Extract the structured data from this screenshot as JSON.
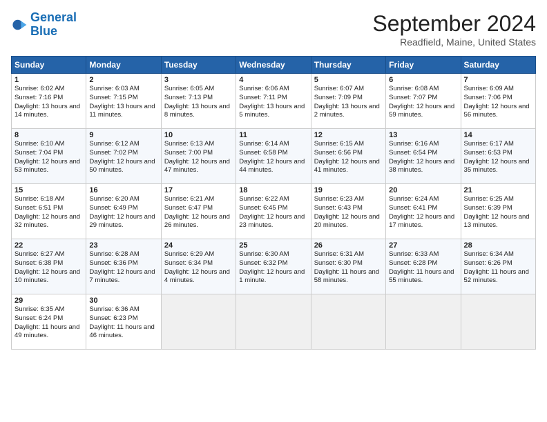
{
  "header": {
    "logo_general": "General",
    "logo_blue": "Blue",
    "month": "September 2024",
    "location": "Readfield, Maine, United States"
  },
  "days_of_week": [
    "Sunday",
    "Monday",
    "Tuesday",
    "Wednesday",
    "Thursday",
    "Friday",
    "Saturday"
  ],
  "weeks": [
    [
      {
        "day": "1",
        "sunrise": "6:02 AM",
        "sunset": "7:16 PM",
        "daylight": "13 hours and 14 minutes."
      },
      {
        "day": "2",
        "sunrise": "6:03 AM",
        "sunset": "7:15 PM",
        "daylight": "13 hours and 11 minutes."
      },
      {
        "day": "3",
        "sunrise": "6:05 AM",
        "sunset": "7:13 PM",
        "daylight": "13 hours and 8 minutes."
      },
      {
        "day": "4",
        "sunrise": "6:06 AM",
        "sunset": "7:11 PM",
        "daylight": "13 hours and 5 minutes."
      },
      {
        "day": "5",
        "sunrise": "6:07 AM",
        "sunset": "7:09 PM",
        "daylight": "13 hours and 2 minutes."
      },
      {
        "day": "6",
        "sunrise": "6:08 AM",
        "sunset": "7:07 PM",
        "daylight": "12 hours and 59 minutes."
      },
      {
        "day": "7",
        "sunrise": "6:09 AM",
        "sunset": "7:06 PM",
        "daylight": "12 hours and 56 minutes."
      }
    ],
    [
      {
        "day": "8",
        "sunrise": "6:10 AM",
        "sunset": "7:04 PM",
        "daylight": "12 hours and 53 minutes."
      },
      {
        "day": "9",
        "sunrise": "6:12 AM",
        "sunset": "7:02 PM",
        "daylight": "12 hours and 50 minutes."
      },
      {
        "day": "10",
        "sunrise": "6:13 AM",
        "sunset": "7:00 PM",
        "daylight": "12 hours and 47 minutes."
      },
      {
        "day": "11",
        "sunrise": "6:14 AM",
        "sunset": "6:58 PM",
        "daylight": "12 hours and 44 minutes."
      },
      {
        "day": "12",
        "sunrise": "6:15 AM",
        "sunset": "6:56 PM",
        "daylight": "12 hours and 41 minutes."
      },
      {
        "day": "13",
        "sunrise": "6:16 AM",
        "sunset": "6:54 PM",
        "daylight": "12 hours and 38 minutes."
      },
      {
        "day": "14",
        "sunrise": "6:17 AM",
        "sunset": "6:53 PM",
        "daylight": "12 hours and 35 minutes."
      }
    ],
    [
      {
        "day": "15",
        "sunrise": "6:18 AM",
        "sunset": "6:51 PM",
        "daylight": "12 hours and 32 minutes."
      },
      {
        "day": "16",
        "sunrise": "6:20 AM",
        "sunset": "6:49 PM",
        "daylight": "12 hours and 29 minutes."
      },
      {
        "day": "17",
        "sunrise": "6:21 AM",
        "sunset": "6:47 PM",
        "daylight": "12 hours and 26 minutes."
      },
      {
        "day": "18",
        "sunrise": "6:22 AM",
        "sunset": "6:45 PM",
        "daylight": "12 hours and 23 minutes."
      },
      {
        "day": "19",
        "sunrise": "6:23 AM",
        "sunset": "6:43 PM",
        "daylight": "12 hours and 20 minutes."
      },
      {
        "day": "20",
        "sunrise": "6:24 AM",
        "sunset": "6:41 PM",
        "daylight": "12 hours and 17 minutes."
      },
      {
        "day": "21",
        "sunrise": "6:25 AM",
        "sunset": "6:39 PM",
        "daylight": "12 hours and 13 minutes."
      }
    ],
    [
      {
        "day": "22",
        "sunrise": "6:27 AM",
        "sunset": "6:38 PM",
        "daylight": "12 hours and 10 minutes."
      },
      {
        "day": "23",
        "sunrise": "6:28 AM",
        "sunset": "6:36 PM",
        "daylight": "12 hours and 7 minutes."
      },
      {
        "day": "24",
        "sunrise": "6:29 AM",
        "sunset": "6:34 PM",
        "daylight": "12 hours and 4 minutes."
      },
      {
        "day": "25",
        "sunrise": "6:30 AM",
        "sunset": "6:32 PM",
        "daylight": "12 hours and 1 minute."
      },
      {
        "day": "26",
        "sunrise": "6:31 AM",
        "sunset": "6:30 PM",
        "daylight": "11 hours and 58 minutes."
      },
      {
        "day": "27",
        "sunrise": "6:33 AM",
        "sunset": "6:28 PM",
        "daylight": "11 hours and 55 minutes."
      },
      {
        "day": "28",
        "sunrise": "6:34 AM",
        "sunset": "6:26 PM",
        "daylight": "11 hours and 52 minutes."
      }
    ],
    [
      {
        "day": "29",
        "sunrise": "6:35 AM",
        "sunset": "6:24 PM",
        "daylight": "11 hours and 49 minutes."
      },
      {
        "day": "30",
        "sunrise": "6:36 AM",
        "sunset": "6:23 PM",
        "daylight": "11 hours and 46 minutes."
      },
      null,
      null,
      null,
      null,
      null
    ]
  ],
  "labels": {
    "sunrise_prefix": "Sunrise: ",
    "sunset_prefix": "Sunset: ",
    "daylight_prefix": "Daylight: "
  }
}
